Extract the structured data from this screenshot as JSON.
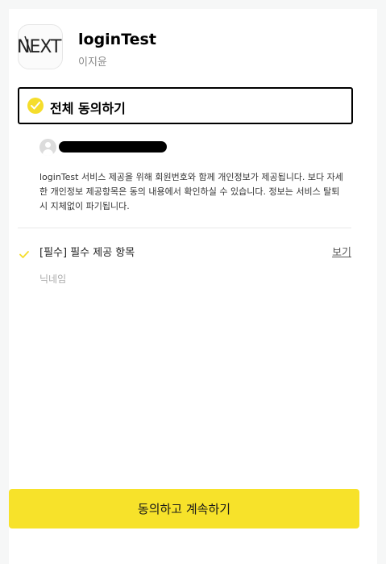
{
  "app": {
    "logo_text": "NEXT",
    "name": "loginTest",
    "sub": "이지윤"
  },
  "agree_all": {
    "label": "전체 동의하기",
    "checked": true
  },
  "notice": "loginTest 서비스 제공을 위해 회원번호와 함께 개인정보가 제공됩니다. 보다 자세한 개인정보 제공항목은 동의 내용에서 확인하실 수 있습니다. 정보는 서비스 탈퇴 시 지체없이 파기됩니다.",
  "items": [
    {
      "label": "[필수] 필수 제공 항목",
      "view_label": "보기",
      "checked": true,
      "sub": "닉네임"
    }
  ],
  "continue_label": "동의하고 계속하기",
  "colors": {
    "accent": "#f7e22a",
    "check": "#f5dd2c",
    "border": "#000000"
  }
}
